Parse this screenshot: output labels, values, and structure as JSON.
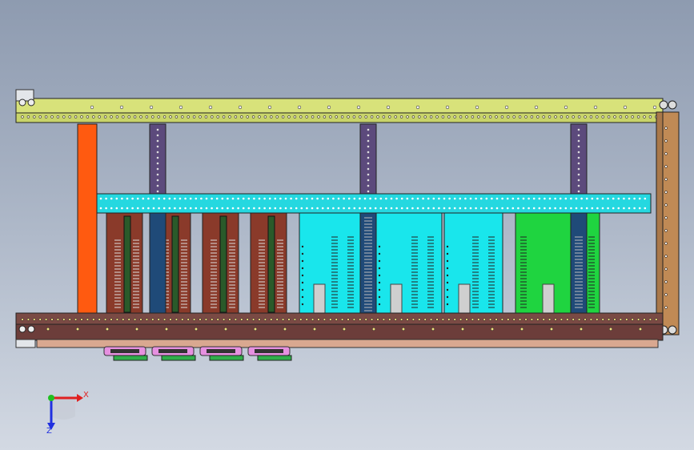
{
  "viewport": {
    "title": "",
    "background": "gradient-grey-blue"
  },
  "colors": {
    "top_rail": "#d8e27a",
    "top_rail_dark": "#b9c45a",
    "side_bracket": "#c08a55",
    "bottom_rail": "#7a4a44",
    "orange_card": "#ff5a10",
    "purple_post": "#5c4a7c",
    "cyan_bar": "#25d8e0",
    "cyan_card": "#19e6ec",
    "brown_card": "#8a3a2a",
    "green_card": "#1fd440",
    "navy_post": "#1f4a78",
    "pink_tab": "#e690e0",
    "green_tab": "#2fae4a"
  },
  "triad": {
    "x_label": "X",
    "z_label": "Z",
    "x_color": "#e02020",
    "y_color": "#20c020",
    "z_color": "#2030e0"
  },
  "assembly": {
    "left_brown_cards": 4,
    "cyan_cards": 3,
    "green_cards": 1,
    "purple_posts": 3,
    "bottom_tabs": 4
  }
}
